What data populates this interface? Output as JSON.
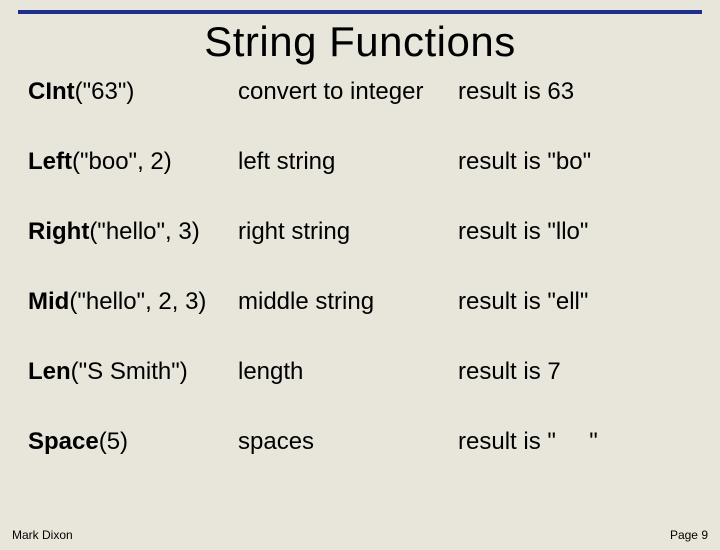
{
  "title": "String Functions",
  "rows": [
    {
      "fn": "CInt",
      "args": "(\"63\")",
      "desc": "convert to integer",
      "res": "result is 63"
    },
    {
      "fn": "Left",
      "args": "(\"boo\", 2)",
      "desc": "left string",
      "res": "result is \"bo\""
    },
    {
      "fn": "Right",
      "args": "(\"hello\", 3)",
      "desc": "right string",
      "res": "result is \"llo\""
    },
    {
      "fn": "Mid",
      "args": "(\"hello\", 2, 3)",
      "desc": "middle string",
      "res": "result is \"ell\""
    },
    {
      "fn": "Len",
      "args": "(\"S Smith\")",
      "desc": "length",
      "res": "result is 7"
    },
    {
      "fn": "Space",
      "args": "(5)",
      "desc": "spaces",
      "res": "result is \"     \""
    }
  ],
  "footer": {
    "author": "Mark Dixon",
    "page": "Page 9"
  }
}
